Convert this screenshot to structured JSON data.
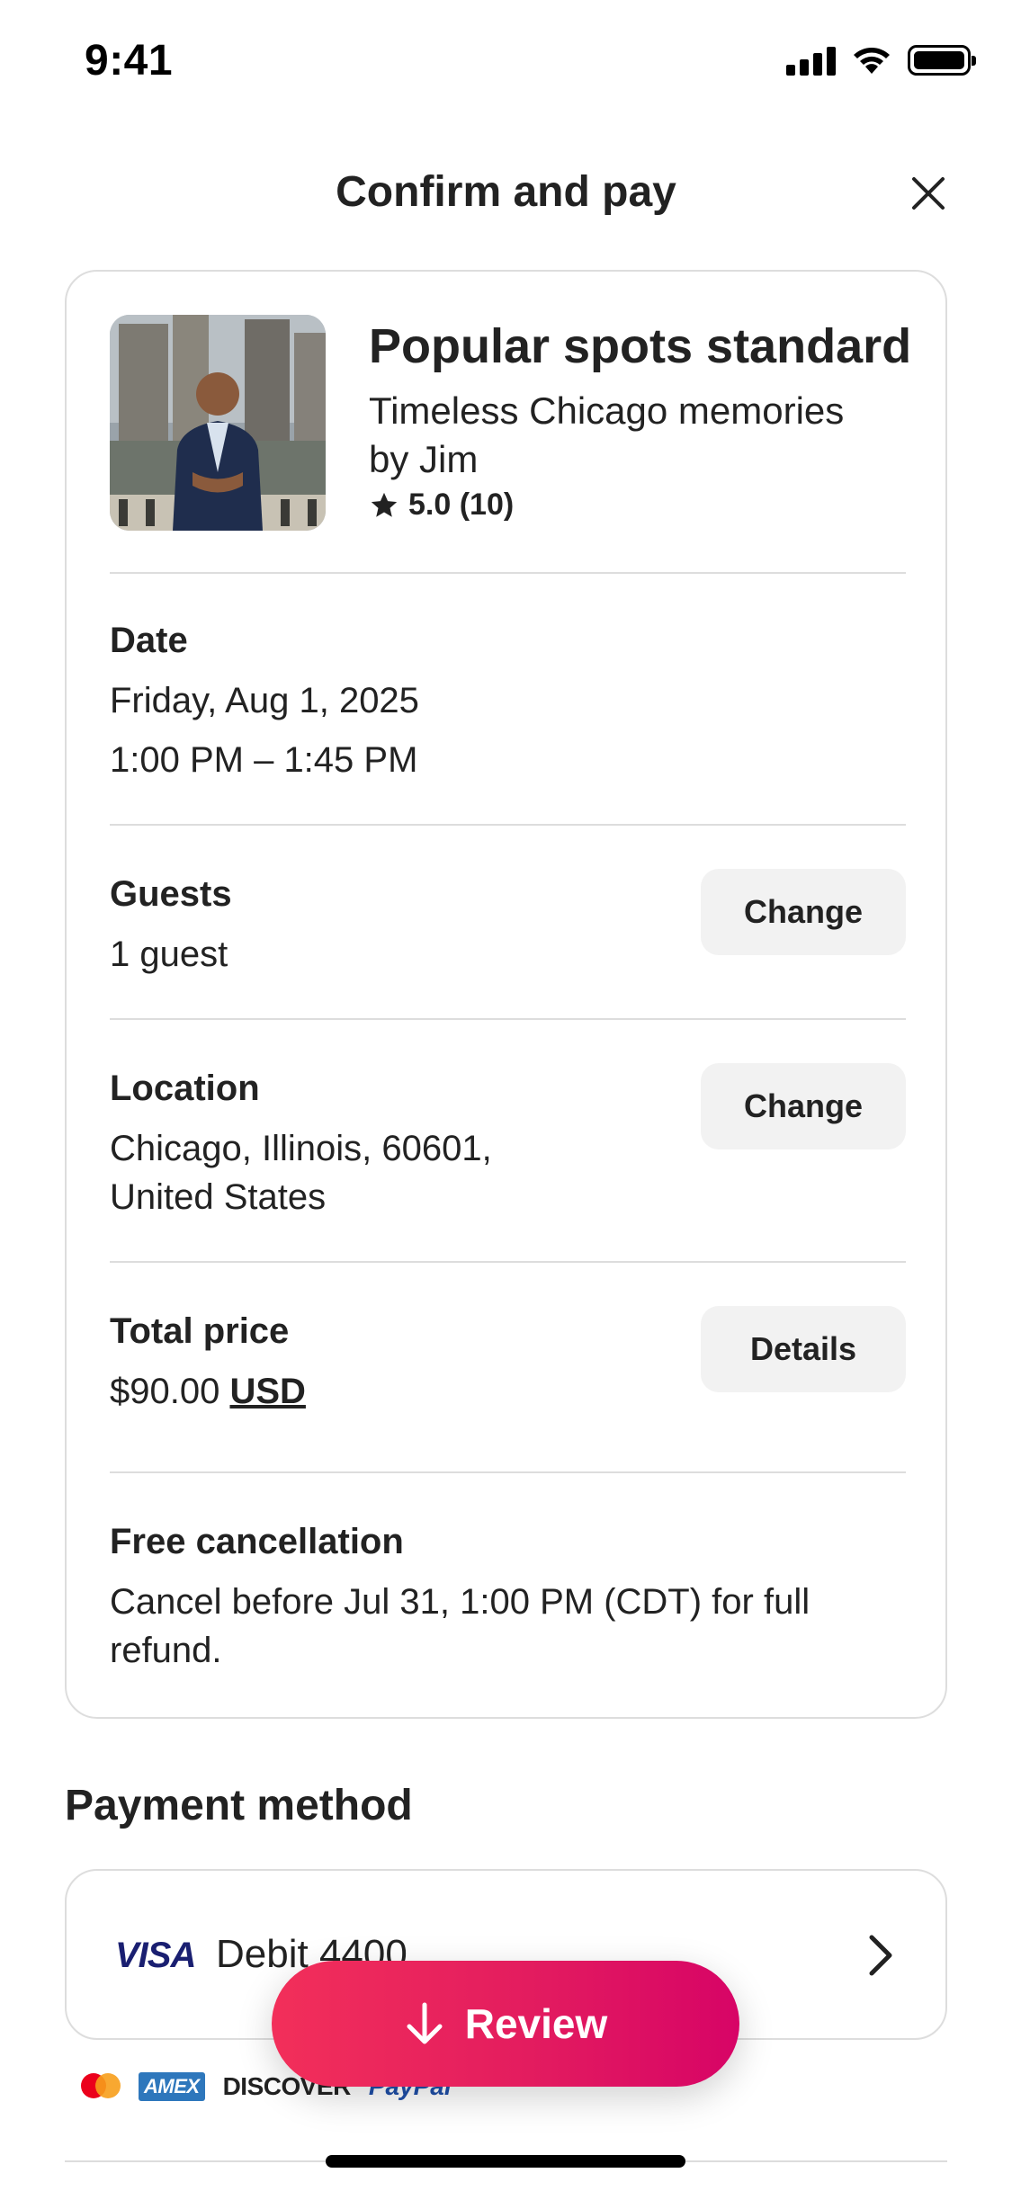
{
  "status_bar": {
    "time": "9:41",
    "icons": [
      "signal-icon",
      "wifi-icon",
      "battery-icon"
    ]
  },
  "header": {
    "title": "Confirm and pay",
    "close_icon": "close-icon"
  },
  "listing": {
    "title": "Popular spots standard",
    "subtitle": "Timeless Chicago memories by Jim",
    "rating": "5.0 (10)",
    "rating_icon": "star-icon"
  },
  "date": {
    "label": "Date",
    "day": "Friday, Aug 1, 2025",
    "time_range": "1:00 PM – 1:45 PM"
  },
  "guests": {
    "label": "Guests",
    "value": "1 guest",
    "button": "Change"
  },
  "location": {
    "label": "Location",
    "value": "Chicago, Illinois, 60601, United States",
    "button": "Change"
  },
  "total_price": {
    "label": "Total price",
    "amount": "$90.00",
    "currency": "USD",
    "button": "Details"
  },
  "cancellation": {
    "label": "Free cancellation",
    "text": "Cancel before Jul 31, 1:00 PM (CDT) for full refund."
  },
  "payment": {
    "heading": "Payment method",
    "card_brand": "VISA",
    "card_label": "Debit 4400",
    "accepted": [
      "AMEX",
      "DISCOVER",
      "PayPal"
    ]
  },
  "review_button": {
    "label": "Review",
    "icon": "arrow-down-icon"
  },
  "colors": {
    "brand": "#e31c5f",
    "text": "#222222",
    "border": "#dddddd",
    "button_bg": "#f2f2f2"
  }
}
